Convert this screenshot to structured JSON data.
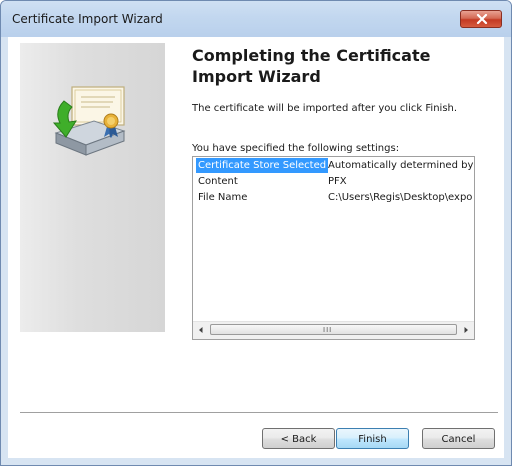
{
  "window": {
    "title": "Certificate Import Wizard"
  },
  "wizard": {
    "heading": "Completing the Certificate Import Wizard",
    "info": "The certificate will be imported after you click Finish.",
    "settings_label": "You have specified the following settings:"
  },
  "settings": [
    {
      "name": "Certificate Store Selected",
      "value": "Automatically determined by t"
    },
    {
      "name": "Content",
      "value": "PFX"
    },
    {
      "name": "File Name",
      "value": "C:\\Users\\Regis\\Desktop\\expo"
    }
  ],
  "scrollbar": {
    "grip": "III"
  },
  "buttons": {
    "back": "< Back",
    "finish": "Finish",
    "cancel": "Cancel"
  },
  "icons": {
    "close": "close-icon",
    "wizard_art": "certificate-import-icon"
  },
  "colors": {
    "selection": "#3399ff",
    "close_button": "#c43a23"
  }
}
